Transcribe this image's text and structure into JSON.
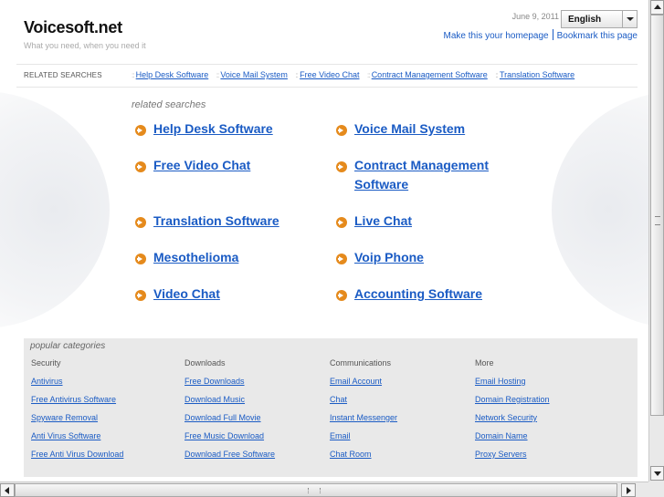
{
  "site": {
    "title": "Voicesoft.net",
    "tagline": "What you need, when you need it"
  },
  "header": {
    "date": "June 9, 2011",
    "language": "English",
    "make_homepage": "Make this your homepage",
    "bookmark": "Bookmark this page"
  },
  "related_bar": {
    "label": "RELATED SEARCHES",
    "items": [
      "Help Desk Software",
      "Voice Mail System",
      "Free Video Chat",
      "Contract Management Software",
      "Translation Software"
    ]
  },
  "related_searches": {
    "caption": "related searches",
    "links": [
      "Help Desk Software",
      "Voice Mail System",
      "Free Video Chat",
      "Contract Management",
      "Software",
      "Translation Software",
      "Live Chat",
      "Mesothelioma",
      "Voip Phone",
      "Video Chat",
      "Accounting Software"
    ]
  },
  "popular": {
    "title": "popular categories",
    "columns": [
      {
        "head": "Security",
        "links": [
          "Antivirus",
          "Free Antivirus Software",
          "Spyware Removal",
          "Anti Virus Software",
          "Free Anti Virus Download"
        ]
      },
      {
        "head": "Downloads",
        "links": [
          "Free Downloads",
          "Download Music",
          "Download Full Movie",
          "Free Music Download",
          "Download Free Software"
        ]
      },
      {
        "head": "Communications",
        "links": [
          "Email Account",
          "Chat",
          "Instant Messenger",
          "Email",
          "Chat Room"
        ]
      },
      {
        "head": "More",
        "links": [
          "Email Hosting",
          "Domain Registration",
          "Network Security",
          "Domain Name",
          "Proxy Servers"
        ]
      }
    ]
  },
  "colors": {
    "link": "#1a5bc4",
    "arrow": "#e58a1c",
    "panel": "#e9e9e9"
  }
}
